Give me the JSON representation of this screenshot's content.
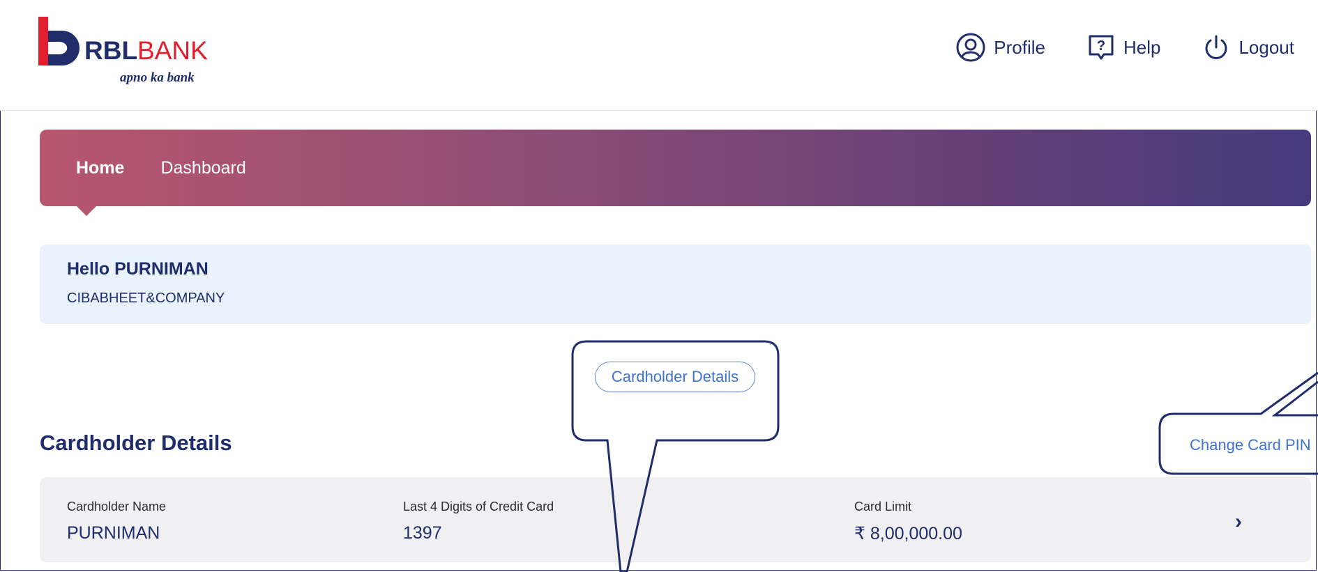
{
  "brand": {
    "name_part1": "RBL",
    "name_part2": "BANK",
    "tagline": "apno ka bank"
  },
  "top_nav": {
    "profile_label": "Profile",
    "help_label": "Help",
    "logout_label": "Logout"
  },
  "banner": {
    "tabs": [
      {
        "label": "Home",
        "active": true
      },
      {
        "label": "Dashboard",
        "active": false
      }
    ]
  },
  "greeting": {
    "name": "Hello PURNIMAN",
    "company": "CIBABHEET&COMPANY"
  },
  "cardholder_pill": "Cardholder Details",
  "section": {
    "title": "Cardholder Details",
    "change_pin_label": "Change Card PIN"
  },
  "card": {
    "name_label": "Cardholder Name",
    "name_value": "PURNIMAN",
    "digits_label": "Last 4 Digits of Credit Card",
    "digits_value": "1397",
    "limit_label": "Card Limit",
    "limit_value": "₹ 8,00,000.00"
  },
  "colors": {
    "brand_navy": "#1f2d6b",
    "brand_red": "#e01e2c",
    "link_blue": "#3f73cf",
    "greeting_bg": "#eaf2fd",
    "card_bg": "#f0eff1"
  }
}
